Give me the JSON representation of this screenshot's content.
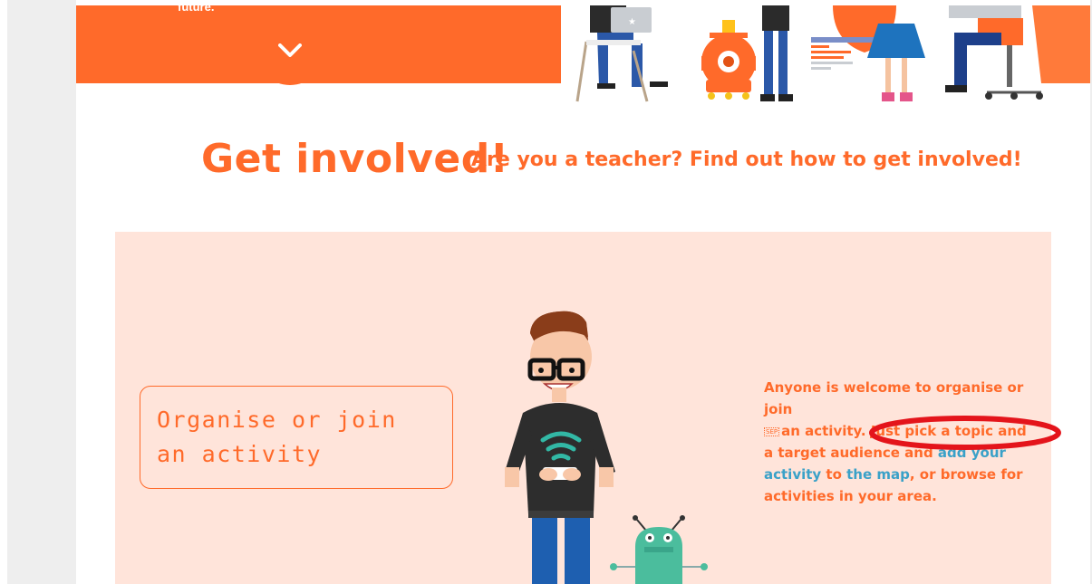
{
  "hero": {
    "tagline_fragment": "future."
  },
  "heading": {
    "title": "Get involved!",
    "subtitle": "Are you a teacher? Find out how to get involved!"
  },
  "activity": {
    "box_label_line1": "Organise or join",
    "box_label_line2": "an activity",
    "desc_part1": "Anyone is welcome to organise or join",
    "desc_sep": "SEP",
    "desc_part2": "an activity. Just pick a topic and a target audience and ",
    "link_add_activity": "add your activity",
    "desc_part3": " to ",
    "link_map": "the map",
    "desc_part4": ", or browse for activities in your area."
  },
  "colors": {
    "brand_orange": "#ff6a2a",
    "panel_bg": "#ffe4da",
    "link_blue": "#3aa1c8",
    "annotation_red": "#e4141b"
  },
  "icons": [
    "chevron-down-icon"
  ]
}
